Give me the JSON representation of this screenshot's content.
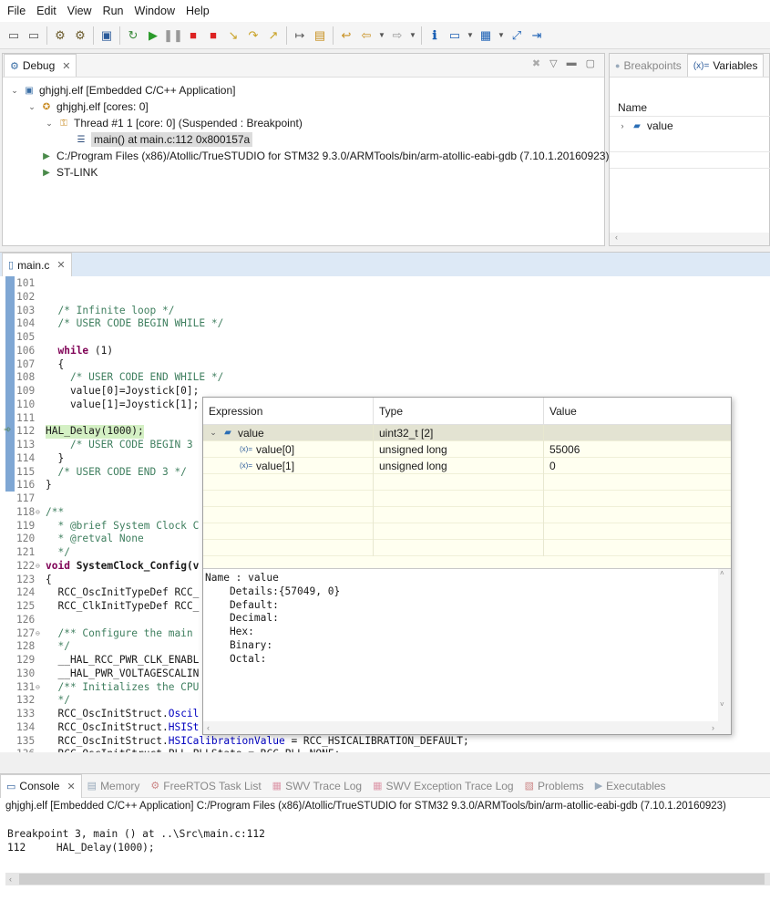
{
  "menu": [
    "File",
    "Edit",
    "View",
    "Run",
    "Window",
    "Help"
  ],
  "debug_view": {
    "tab_label": "Debug",
    "tree": [
      {
        "label": "ghjghj.elf [Embedded C/C++ Application]",
        "indent": 0,
        "expanded": true,
        "icon": "c-app-icon"
      },
      {
        "label": "ghjghj.elf [cores: 0]",
        "indent": 1,
        "expanded": true,
        "icon": "process-icon"
      },
      {
        "label": "Thread #1 1 [core: 0] (Suspended : Breakpoint)",
        "indent": 2,
        "expanded": true,
        "icon": "thread-icon"
      },
      {
        "label": "main() at main.c:112 0x800157a",
        "indent": 3,
        "expanded": null,
        "icon": "stack-frame-icon",
        "selected": true
      },
      {
        "label": "C:/Program Files (x86)/Atollic/TrueSTUDIO for STM32 9.3.0/ARMTools/bin/arm-atollic-eabi-gdb (7.10.1.20160923)",
        "indent": 1,
        "expanded": null,
        "icon": "gdb-icon"
      },
      {
        "label": "ST-LINK",
        "indent": 1,
        "expanded": null,
        "icon": "gdb-icon"
      }
    ]
  },
  "variables_view": {
    "tabs": [
      {
        "label": "Breakpoints",
        "active": false
      },
      {
        "label": "Variables",
        "active": true
      }
    ],
    "column_name": "Name",
    "rows": [
      {
        "label": "value"
      }
    ]
  },
  "editor": {
    "tab_label": "main.c",
    "lines": [
      {
        "n": "101",
        "segs": []
      },
      {
        "n": "102",
        "segs": []
      },
      {
        "n": "103",
        "segs": [
          {
            "t": "  /* Infinite loop */",
            "c": "cmt"
          }
        ]
      },
      {
        "n": "104",
        "segs": [
          {
            "t": "  /* USER CODE BEGIN WHILE */",
            "c": "cmt"
          }
        ]
      },
      {
        "n": "105",
        "segs": []
      },
      {
        "n": "106",
        "segs": [
          {
            "t": "  "
          },
          {
            "t": "while",
            "c": "kw"
          },
          {
            "t": " (1)"
          }
        ]
      },
      {
        "n": "107",
        "segs": [
          {
            "t": "  {"
          }
        ]
      },
      {
        "n": "108",
        "segs": [
          {
            "t": "    /* USER CODE END WHILE */",
            "c": "cmt"
          }
        ]
      },
      {
        "n": "109",
        "segs": [
          {
            "t": "    value[0]=Joystick[0];"
          }
        ]
      },
      {
        "n": "110",
        "segs": [
          {
            "t": "    value[1]=Joystick[1];"
          }
        ]
      },
      {
        "n": "111",
        "segs": []
      },
      {
        "n": "112",
        "segs": [
          {
            "t": "HAL_Delay(1000);"
          }
        ],
        "current": true
      },
      {
        "n": "113",
        "segs": [
          {
            "t": "    /* USER CODE BEGIN 3",
            "c": "cmt"
          }
        ]
      },
      {
        "n": "114",
        "segs": [
          {
            "t": "  }"
          }
        ]
      },
      {
        "n": "115",
        "segs": [
          {
            "t": "  /* USER CODE END 3 */",
            "c": "cmt"
          }
        ]
      },
      {
        "n": "116",
        "segs": [
          {
            "t": "}"
          }
        ]
      },
      {
        "n": "117",
        "segs": []
      },
      {
        "n": "118",
        "fold": true,
        "segs": [
          {
            "t": "/**",
            "c": "cmt"
          }
        ]
      },
      {
        "n": "119",
        "segs": [
          {
            "t": "  * @brief System Clock C",
            "c": "cmt"
          }
        ]
      },
      {
        "n": "120",
        "segs": [
          {
            "t": "  * @retval None",
            "c": "cmt"
          }
        ]
      },
      {
        "n": "121",
        "segs": [
          {
            "t": "  */",
            "c": "cmt"
          }
        ]
      },
      {
        "n": "122",
        "fold": true,
        "segs": [
          {
            "t": "void",
            "c": "kw"
          },
          {
            "t": " "
          },
          {
            "t": "SystemClock_Config(v",
            "c": "bold"
          }
        ]
      },
      {
        "n": "123",
        "segs": [
          {
            "t": "{"
          }
        ]
      },
      {
        "n": "124",
        "segs": [
          {
            "t": "  RCC_OscInitTypeDef RCC_"
          }
        ]
      },
      {
        "n": "125",
        "segs": [
          {
            "t": "  RCC_ClkInitTypeDef RCC_"
          }
        ]
      },
      {
        "n": "126",
        "segs": []
      },
      {
        "n": "127",
        "fold": true,
        "segs": [
          {
            "t": "  /** Configure the main",
            "c": "cmt"
          }
        ]
      },
      {
        "n": "128",
        "segs": [
          {
            "t": "  */",
            "c": "cmt"
          }
        ]
      },
      {
        "n": "129",
        "segs": [
          {
            "t": "  __HAL_RCC_PWR_CLK_ENABL"
          }
        ]
      },
      {
        "n": "130",
        "segs": [
          {
            "t": "  __HAL_PWR_VOLTAGESCALIN"
          }
        ]
      },
      {
        "n": "131",
        "fold": true,
        "segs": [
          {
            "t": "  /** Initializes the CPU",
            "c": "cmt"
          }
        ]
      },
      {
        "n": "132",
        "segs": [
          {
            "t": "  */",
            "c": "cmt"
          }
        ]
      },
      {
        "n": "133",
        "segs": [
          {
            "t": "  RCC_OscInitStruct."
          },
          {
            "t": "Oscil",
            "c": "fld"
          }
        ]
      },
      {
        "n": "134",
        "segs": [
          {
            "t": "  RCC_OscInitStruct."
          },
          {
            "t": "HSISt",
            "c": "fld"
          }
        ]
      },
      {
        "n": "135",
        "segs": [
          {
            "t": "  RCC_OscInitStruct."
          },
          {
            "t": "HSICalibrationValue",
            "c": "fld"
          },
          {
            "t": " = RCC_HSICALIBRATION_DEFAULT;"
          }
        ]
      },
      {
        "n": "136",
        "segs": [
          {
            "t": "  RCC_OscInitStruct.PLL.PLLState = RCC_PLL_NONE;"
          }
        ]
      }
    ]
  },
  "hover_popup": {
    "columns": [
      "Expression",
      "Type",
      "Value"
    ],
    "rows": [
      {
        "expr": "value",
        "type": "uint32_t [2]",
        "value": "",
        "indent": 0,
        "expanded": true,
        "selected": true
      },
      {
        "expr": "value[0]",
        "type": "unsigned long",
        "value": "55006",
        "indent": 1
      },
      {
        "expr": "value[1]",
        "type": "unsigned long",
        "value": "0",
        "indent": 1
      }
    ],
    "details": "Name : value\n    Details:{57049, 0}\n    Default:\n    Decimal:\n    Hex:\n    Binary:\n    Octal:"
  },
  "console": {
    "tabs": [
      {
        "label": "Console",
        "active": true,
        "icon": "console-icon"
      },
      {
        "label": "Memory",
        "active": false,
        "icon": "memory-icon"
      },
      {
        "label": "FreeRTOS Task List",
        "active": false,
        "icon": "task-list-icon"
      },
      {
        "label": "SWV Trace Log",
        "active": false,
        "icon": "trace-log-icon"
      },
      {
        "label": "SWV Exception Trace Log",
        "active": false,
        "icon": "trace-log-icon"
      },
      {
        "label": "Problems",
        "active": false,
        "icon": "problems-icon"
      },
      {
        "label": "Executables",
        "active": false,
        "icon": "executables-icon"
      }
    ],
    "header": "ghjghj.elf [Embedded C/C++ Application] C:/Program Files (x86)/Atollic/TrueSTUDIO for STM32 9.3.0/ARMTools/bin/arm-atollic-eabi-gdb (7.10.1.20160923)",
    "output": [
      "Breakpoint 3, main () at ..\\Src\\main.c:112",
      "112     HAL_Delay(1000);"
    ]
  }
}
